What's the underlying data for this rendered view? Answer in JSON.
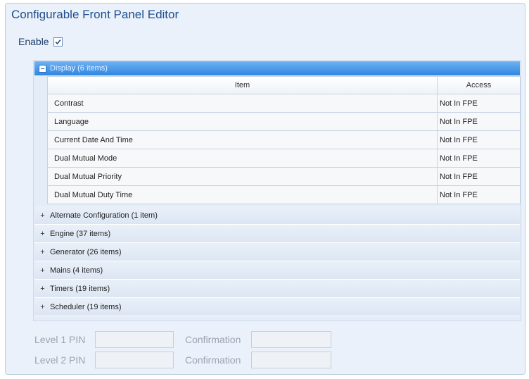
{
  "window": {
    "title": "Configurable Front Panel Editor"
  },
  "enable": {
    "label": "Enable",
    "checked": true
  },
  "display_group": {
    "header": "Display (6 items)",
    "columns": {
      "item": "Item",
      "access": "Access"
    },
    "rows": [
      {
        "item": "Contrast",
        "access": "Not In FPE"
      },
      {
        "item": "Language",
        "access": "Not In FPE"
      },
      {
        "item": "Current Date And Time",
        "access": "Not In FPE"
      },
      {
        "item": "Dual Mutual Mode",
        "access": "Not In FPE"
      },
      {
        "item": "Dual Mutual Priority",
        "access": "Not In FPE"
      },
      {
        "item": "Dual Mutual Duty Time",
        "access": "Not In FPE"
      }
    ]
  },
  "groups": [
    {
      "label": "Alternate Configuration (1 item)",
      "expander": "+"
    },
    {
      "label": "Engine (37 items)",
      "expander": "+"
    },
    {
      "label": "Generator (26 items)",
      "expander": "+"
    },
    {
      "label": "Mains (4 items)",
      "expander": "+"
    },
    {
      "label": "Timers (19 items)",
      "expander": "+"
    },
    {
      "label": "Scheduler (19 items)",
      "expander": "+"
    }
  ],
  "pins": {
    "level1": {
      "label": "Level 1 PIN",
      "value": "",
      "confirmation_label": "Confirmation",
      "confirmation_value": ""
    },
    "level2": {
      "label": "Level 2 PIN",
      "value": "",
      "confirmation_label": "Confirmation",
      "confirmation_value": ""
    }
  },
  "colors": {
    "accent": "#2f86e2",
    "title": "#1f4e8c",
    "panel_bg": "#eaf1fb"
  }
}
